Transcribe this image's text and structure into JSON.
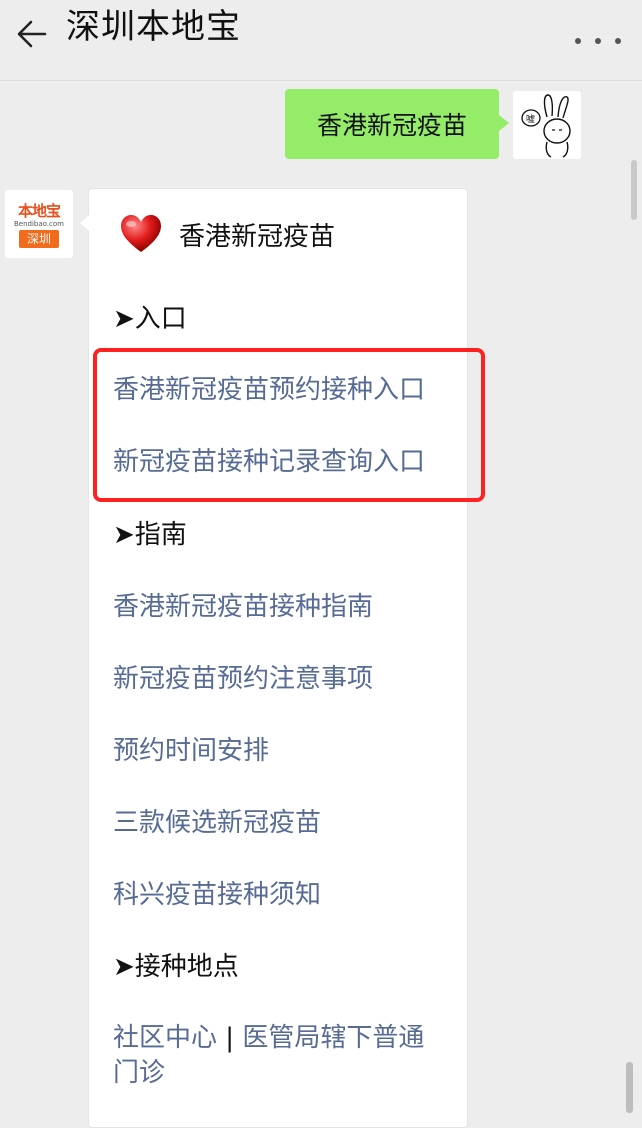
{
  "header": {
    "title": "深圳本地宝",
    "back_icon": "arrow-left-icon",
    "more_icon": "more-dots-icon"
  },
  "sent_message": {
    "text": "香港新冠疫苗",
    "bubble_color": "#95ec69"
  },
  "bot": {
    "logo_text": "本地宝",
    "logo_url": "Bendibao.com",
    "logo_city": "深圳",
    "logo_color": "#f26a1b"
  },
  "reply": {
    "heart_icon": "red-heart-icon",
    "title": "香港新冠疫苗",
    "sections": [
      {
        "heading": "➤入口",
        "links": [
          "香港新冠疫苗预约接种入口",
          "新冠疫苗接种记录查询入口"
        ]
      },
      {
        "heading": "➤指南",
        "links": [
          "香港新冠疫苗接种指南",
          "新冠疫苗预约注意事项",
          "预约时间安排",
          "三款候选新冠疫苗",
          "科兴疫苗接种须知"
        ]
      },
      {
        "heading": "➤接种地点",
        "links": [
          "社区中心",
          "医管局辖下普通",
          "门诊"
        ],
        "separator": "|"
      }
    ],
    "link_color": "#576b95",
    "highlight_color": "#ff2020"
  }
}
